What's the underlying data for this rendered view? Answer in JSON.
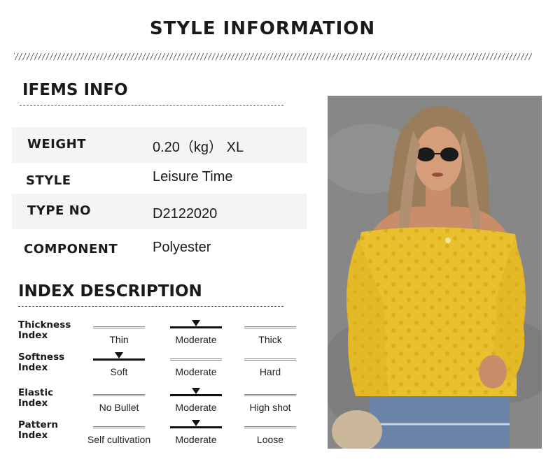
{
  "title": "STYLE INFORMATION",
  "items_info": {
    "heading": "IFEMS INFO",
    "rows": [
      {
        "key": "WEIGHT",
        "value": "0.20（kg） XL"
      },
      {
        "key": "STYLE",
        "value": "Leisure Time"
      },
      {
        "key": "TYPE NO",
        "value": "D2122020"
      },
      {
        "key": "COMPONENT",
        "value": "Polyester"
      }
    ]
  },
  "index_description": {
    "heading": "INDEX DESCRIPTION",
    "rows": [
      {
        "label_1": "Thickness",
        "label_2": "Index",
        "options": [
          "Thin",
          "Moderate",
          "Thick"
        ],
        "selected": 1
      },
      {
        "label_1": "Softness",
        "label_2": "Index",
        "options": [
          "Soft",
          "Moderate",
          "Hard"
        ],
        "selected": 0
      },
      {
        "label_1": "Elastic",
        "label_2": "Index",
        "options": [
          "No Bullet",
          "Moderate",
          "High shot"
        ],
        "selected": 1
      },
      {
        "label_1": "Pattern",
        "label_2": "Index",
        "options": [
          "Self cultivation",
          "Moderate",
          "Loose"
        ],
        "selected": 1
      }
    ]
  },
  "colors": {
    "blouse": "#e9c12e",
    "background_wall": "#8a8a8a",
    "shade_row": "#f4f4f4"
  }
}
